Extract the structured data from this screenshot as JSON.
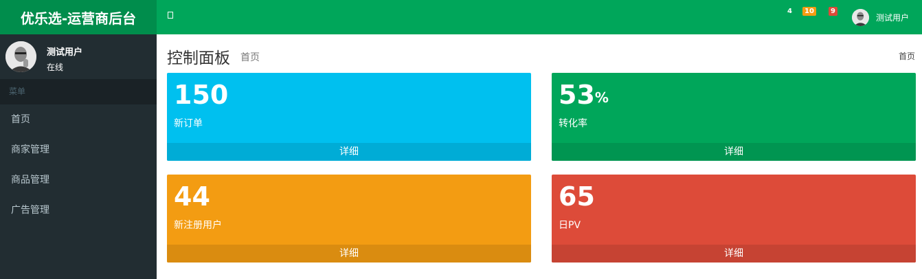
{
  "app": {
    "logo": "优乐选-运营商后台"
  },
  "navbar": {
    "badges": [
      {
        "value": "4",
        "color": "#00a65a"
      },
      {
        "value": "10",
        "color": "#f39c12"
      },
      {
        "value": "9",
        "color": "#dd4b39"
      }
    ],
    "user_name": "测试用户"
  },
  "sidebar": {
    "user_name": "测试用户",
    "user_status": "在线",
    "menu_header": "菜单",
    "items": [
      {
        "label": "首页"
      },
      {
        "label": "商家管理"
      },
      {
        "label": "商品管理"
      },
      {
        "label": "广告管理"
      }
    ]
  },
  "content": {
    "title": "控制面板",
    "subtitle": "首页",
    "breadcrumb": "首页",
    "boxes": [
      {
        "value": "150",
        "suffix": "",
        "label": "新订单",
        "footer": "详细",
        "color": "#00c0ef",
        "footer_color": "#00acd6"
      },
      {
        "value": "53",
        "suffix": "%",
        "label": "转化率",
        "footer": "详细",
        "color": "#00a65a",
        "footer_color": "#009551"
      },
      {
        "value": "44",
        "suffix": "",
        "label": "新注册用户",
        "footer": "详细",
        "color": "#f39c12",
        "footer_color": "#da8c10"
      },
      {
        "value": "65",
        "suffix": "",
        "label": "日PV",
        "footer": "详细",
        "color": "#dd4b39",
        "footer_color": "#c64333"
      }
    ]
  }
}
